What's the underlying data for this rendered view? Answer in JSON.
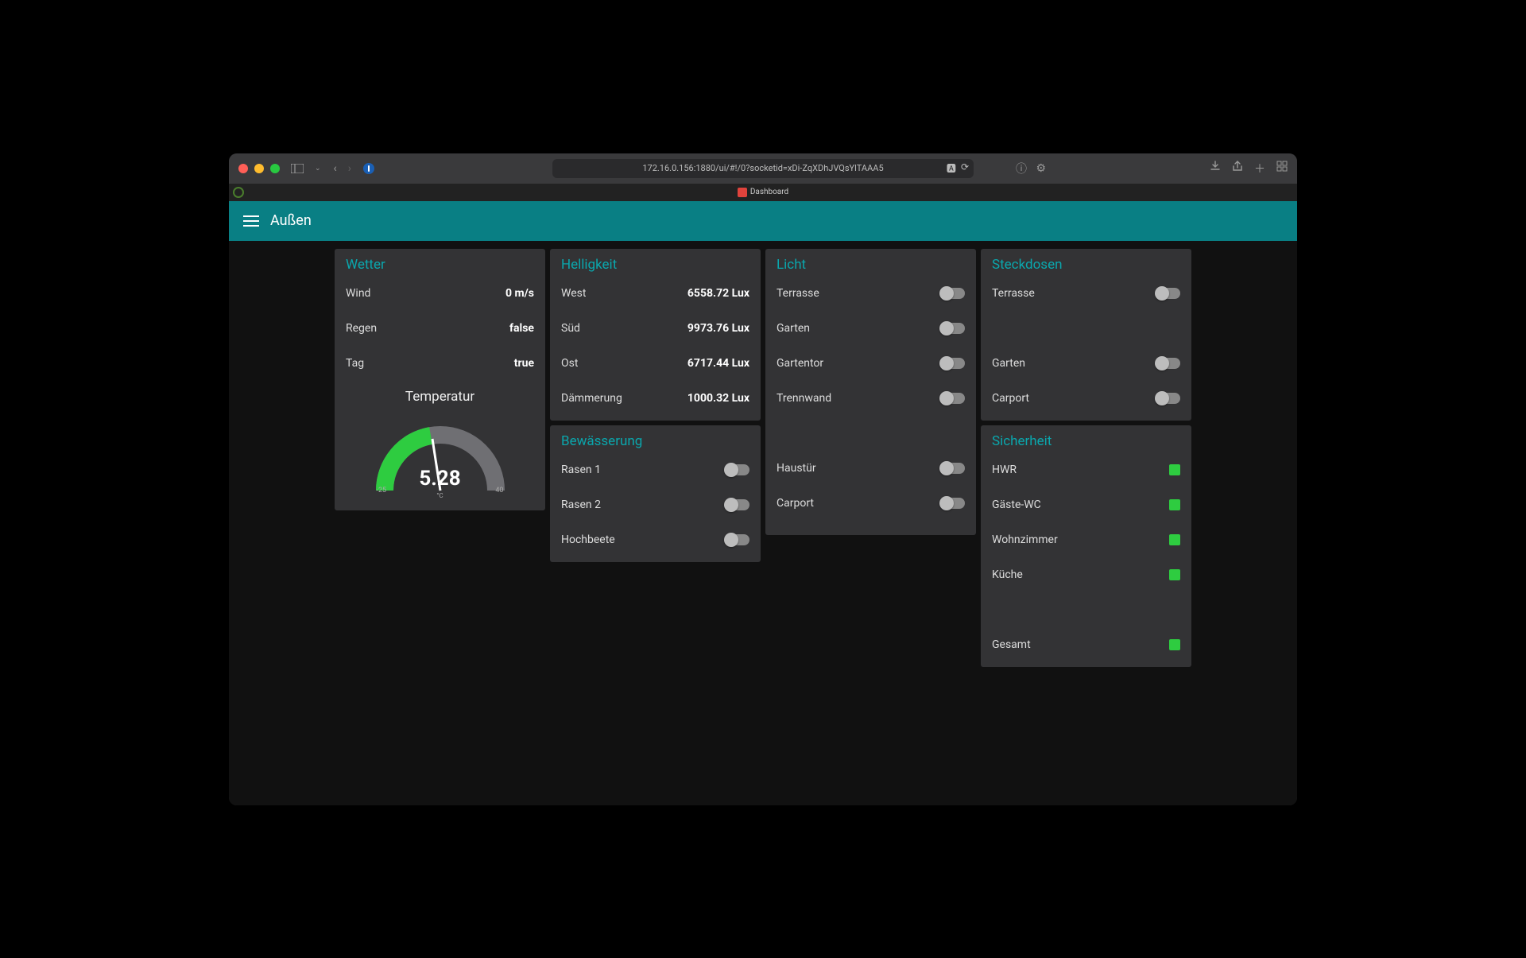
{
  "browser": {
    "url": "172.16.0.156:1880/ui/#!/0?socketid=xDi-ZqXDhJVQsYlTAAA5",
    "tab_title": "Dashboard"
  },
  "header": {
    "title": "Außen"
  },
  "wetter": {
    "title": "Wetter",
    "wind_label": "Wind",
    "wind_value": "0 m/s",
    "regen_label": "Regen",
    "regen_value": "false",
    "tag_label": "Tag",
    "tag_value": "true",
    "gauge": {
      "title": "Temperatur",
      "value": "5.28",
      "unit": "°C",
      "min": "-25",
      "max": "40"
    }
  },
  "helligkeit": {
    "title": "Helligkeit",
    "items": [
      {
        "label": "West",
        "value": "6558.72 Lux"
      },
      {
        "label": "Süd",
        "value": "9973.76 Lux"
      },
      {
        "label": "Ost",
        "value": "6717.44 Lux"
      },
      {
        "label": "Dämmerung",
        "value": "1000.32 Lux"
      }
    ]
  },
  "bewaesserung": {
    "title": "Bewässerung",
    "items": [
      {
        "label": "Rasen 1"
      },
      {
        "label": "Rasen 2"
      },
      {
        "label": "Hochbeete"
      }
    ]
  },
  "licht": {
    "title": "Licht",
    "items": [
      {
        "label": "Terrasse"
      },
      {
        "label": "Garten"
      },
      {
        "label": "Gartentor"
      },
      {
        "label": "Trennwand"
      },
      {
        "label": "Haustür"
      },
      {
        "label": "Carport"
      }
    ]
  },
  "steckdosen": {
    "title": "Steckdosen",
    "items": [
      {
        "label": "Terrasse"
      },
      {
        "label": "Garten"
      },
      {
        "label": "Carport"
      }
    ]
  },
  "sicherheit": {
    "title": "Sicherheit",
    "items": [
      {
        "label": "HWR"
      },
      {
        "label": "Gäste-WC"
      },
      {
        "label": "Wohnzimmer"
      },
      {
        "label": "Küche"
      },
      {
        "label": "Gesamt"
      }
    ]
  },
  "chart_data": {
    "type": "gauge",
    "title": "Temperatur",
    "value": 5.28,
    "min": -25,
    "max": 40,
    "unit": "°C"
  }
}
